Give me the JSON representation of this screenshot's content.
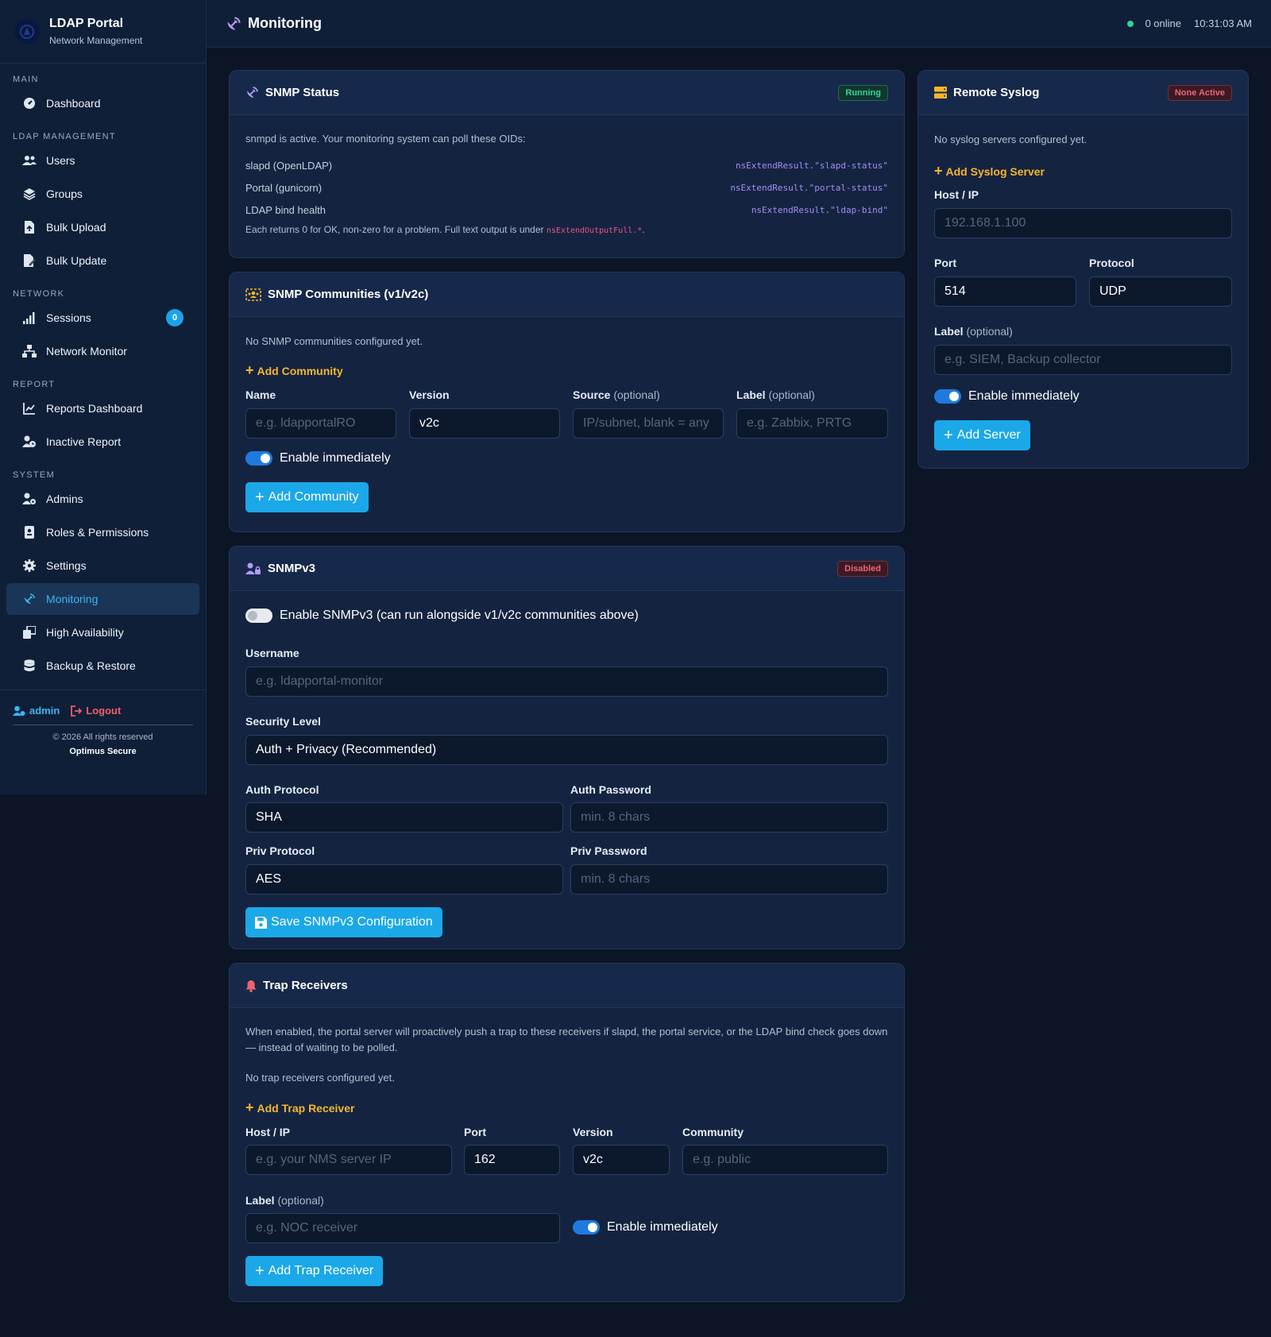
{
  "sidebar": {
    "brand_title": "LDAP Portal",
    "brand_sub": "Network Management",
    "sections": {
      "main": "MAIN",
      "ldap": "LDAP MANAGEMENT",
      "network": "NETWORK",
      "report": "REPORT",
      "system": "SYSTEM"
    },
    "items": {
      "dashboard": "Dashboard",
      "users": "Users",
      "groups": "Groups",
      "bulk_upload": "Bulk Upload",
      "bulk_update": "Bulk Update",
      "sessions": "Sessions",
      "sessions_count": "0",
      "network_monitor": "Network Monitor",
      "reports_dashboard": "Reports Dashboard",
      "inactive_report": "Inactive Report",
      "admins": "Admins",
      "roles": "Roles & Permissions",
      "settings": "Settings",
      "monitoring": "Monitoring",
      "high_availability": "High Availability",
      "backup_restore": "Backup & Restore"
    },
    "user": "admin",
    "logout": "Logout",
    "copyright": "© 2026 All rights reserved",
    "company": "Optimus Secure"
  },
  "topbar": {
    "title": "Monitoring",
    "online": "0 online",
    "time": "10:31:03 AM"
  },
  "snmp_status": {
    "title": "SNMP Status",
    "status": "Running",
    "intro": "snmpd is active. Your monitoring system can poll these OIDs:",
    "oids": [
      {
        "name": "slapd (OpenLDAP)",
        "oid": "nsExtendResult.\"slapd-status\""
      },
      {
        "name": "Portal (gunicorn)",
        "oid": "nsExtendResult.\"portal-status\""
      },
      {
        "name": "LDAP bind health",
        "oid": "nsExtendResult.\"ldap-bind\""
      }
    ],
    "note_text": "Each returns 0 for OK, non-zero for a problem. Full text output is under ",
    "note_code": "nsExtendOutputFull.*",
    "note_end": "."
  },
  "communities": {
    "title": "SNMP Communities (v1/v2c)",
    "empty": "No SNMP communities configured yet.",
    "add_link": "Add Community",
    "name_label": "Name",
    "name_placeholder": "e.g. ldapportalRO",
    "version_label": "Version",
    "version_value": "v2c",
    "source_label": "Source",
    "source_opt": "(optional)",
    "source_placeholder": "IP/subnet, blank = any",
    "label_label": "Label",
    "label_opt": "(optional)",
    "label_placeholder": "e.g. Zabbix, PRTG",
    "enable": "Enable immediately",
    "button": "Add Community"
  },
  "snmpv3": {
    "title": "SNMPv3",
    "status": "Disabled",
    "enable": "Enable SNMPv3 (can run alongside v1/v2c communities above)",
    "username_label": "Username",
    "username_placeholder": "e.g. ldapportal-monitor",
    "security_label": "Security Level",
    "security_value": "Auth + Privacy (Recommended)",
    "auth_protocol_label": "Auth Protocol",
    "auth_protocol_value": "SHA",
    "auth_password_label": "Auth Password",
    "auth_password_placeholder": "min. 8 chars",
    "priv_protocol_label": "Priv Protocol",
    "priv_protocol_value": "AES",
    "priv_password_label": "Priv Password",
    "priv_password_placeholder": "min. 8 chars",
    "button": "Save SNMPv3 Configuration"
  },
  "traps": {
    "title": "Trap Receivers",
    "intro": "When enabled, the portal server will proactively push a trap to these receivers if slapd, the portal service, or the LDAP bind check goes down — instead of waiting to be polled.",
    "empty": "No trap receivers configured yet.",
    "add_link": "Add Trap Receiver",
    "host_label": "Host / IP",
    "host_placeholder": "e.g. your NMS server IP",
    "port_label": "Port",
    "port_value": "162",
    "version_label": "Version",
    "version_value": "v2c",
    "community_label": "Community",
    "community_placeholder": "e.g. public",
    "label_label": "Label",
    "label_opt": "(optional)",
    "label_placeholder": "e.g. NOC receiver",
    "enable": "Enable immediately",
    "button": "Add Trap Receiver"
  },
  "syslog": {
    "title": "Remote Syslog",
    "status": "None Active",
    "empty": "No syslog servers configured yet.",
    "add_link": "Add Syslog Server",
    "host_label": "Host / IP",
    "host_placeholder": "192.168.1.100",
    "port_label": "Port",
    "port_value": "514",
    "protocol_label": "Protocol",
    "protocol_value": "UDP",
    "label_label": "Label",
    "label_opt": "(optional)",
    "label_placeholder": "e.g. SIEM, Backup collector",
    "enable": "Enable immediately",
    "button": "Add Server"
  }
}
